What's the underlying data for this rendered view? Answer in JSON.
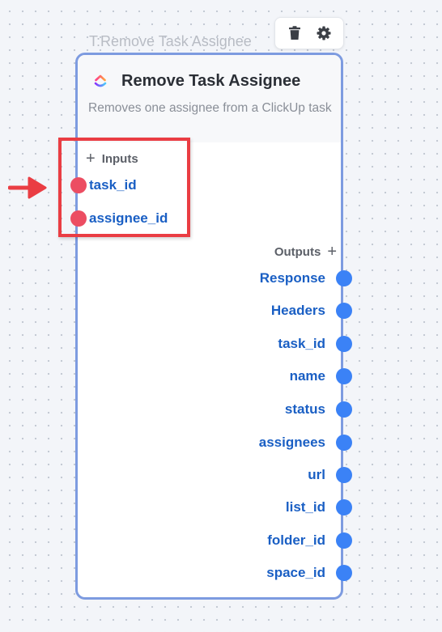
{
  "node": {
    "caption": "T:Remove Task Assignee",
    "title": "Remove Task Assignee",
    "description": "Removes one assignee from a ClickUp task",
    "logo_icon": "clickup-logo-icon"
  },
  "toolbar": {
    "delete_icon": "trash-icon",
    "settings_icon": "gear-icon"
  },
  "inputs": {
    "header": "Inputs",
    "add_icon": "plus-icon",
    "items": [
      {
        "label": "task_id"
      },
      {
        "label": "assignee_id"
      }
    ]
  },
  "outputs": {
    "header": "Outputs",
    "add_icon": "plus-icon",
    "items": [
      {
        "label": "Response"
      },
      {
        "label": "Headers"
      },
      {
        "label": "task_id"
      },
      {
        "label": "name"
      },
      {
        "label": "status"
      },
      {
        "label": "assignees"
      },
      {
        "label": "url"
      },
      {
        "label": "list_id"
      },
      {
        "label": "folder_id"
      },
      {
        "label": "space_id"
      }
    ]
  },
  "colors": {
    "card_border": "#7d9be0",
    "input_handle": "#ec4d62",
    "output_handle": "#3b82f6",
    "field_text": "#1a5fc4",
    "highlight": "#ea3d43"
  }
}
